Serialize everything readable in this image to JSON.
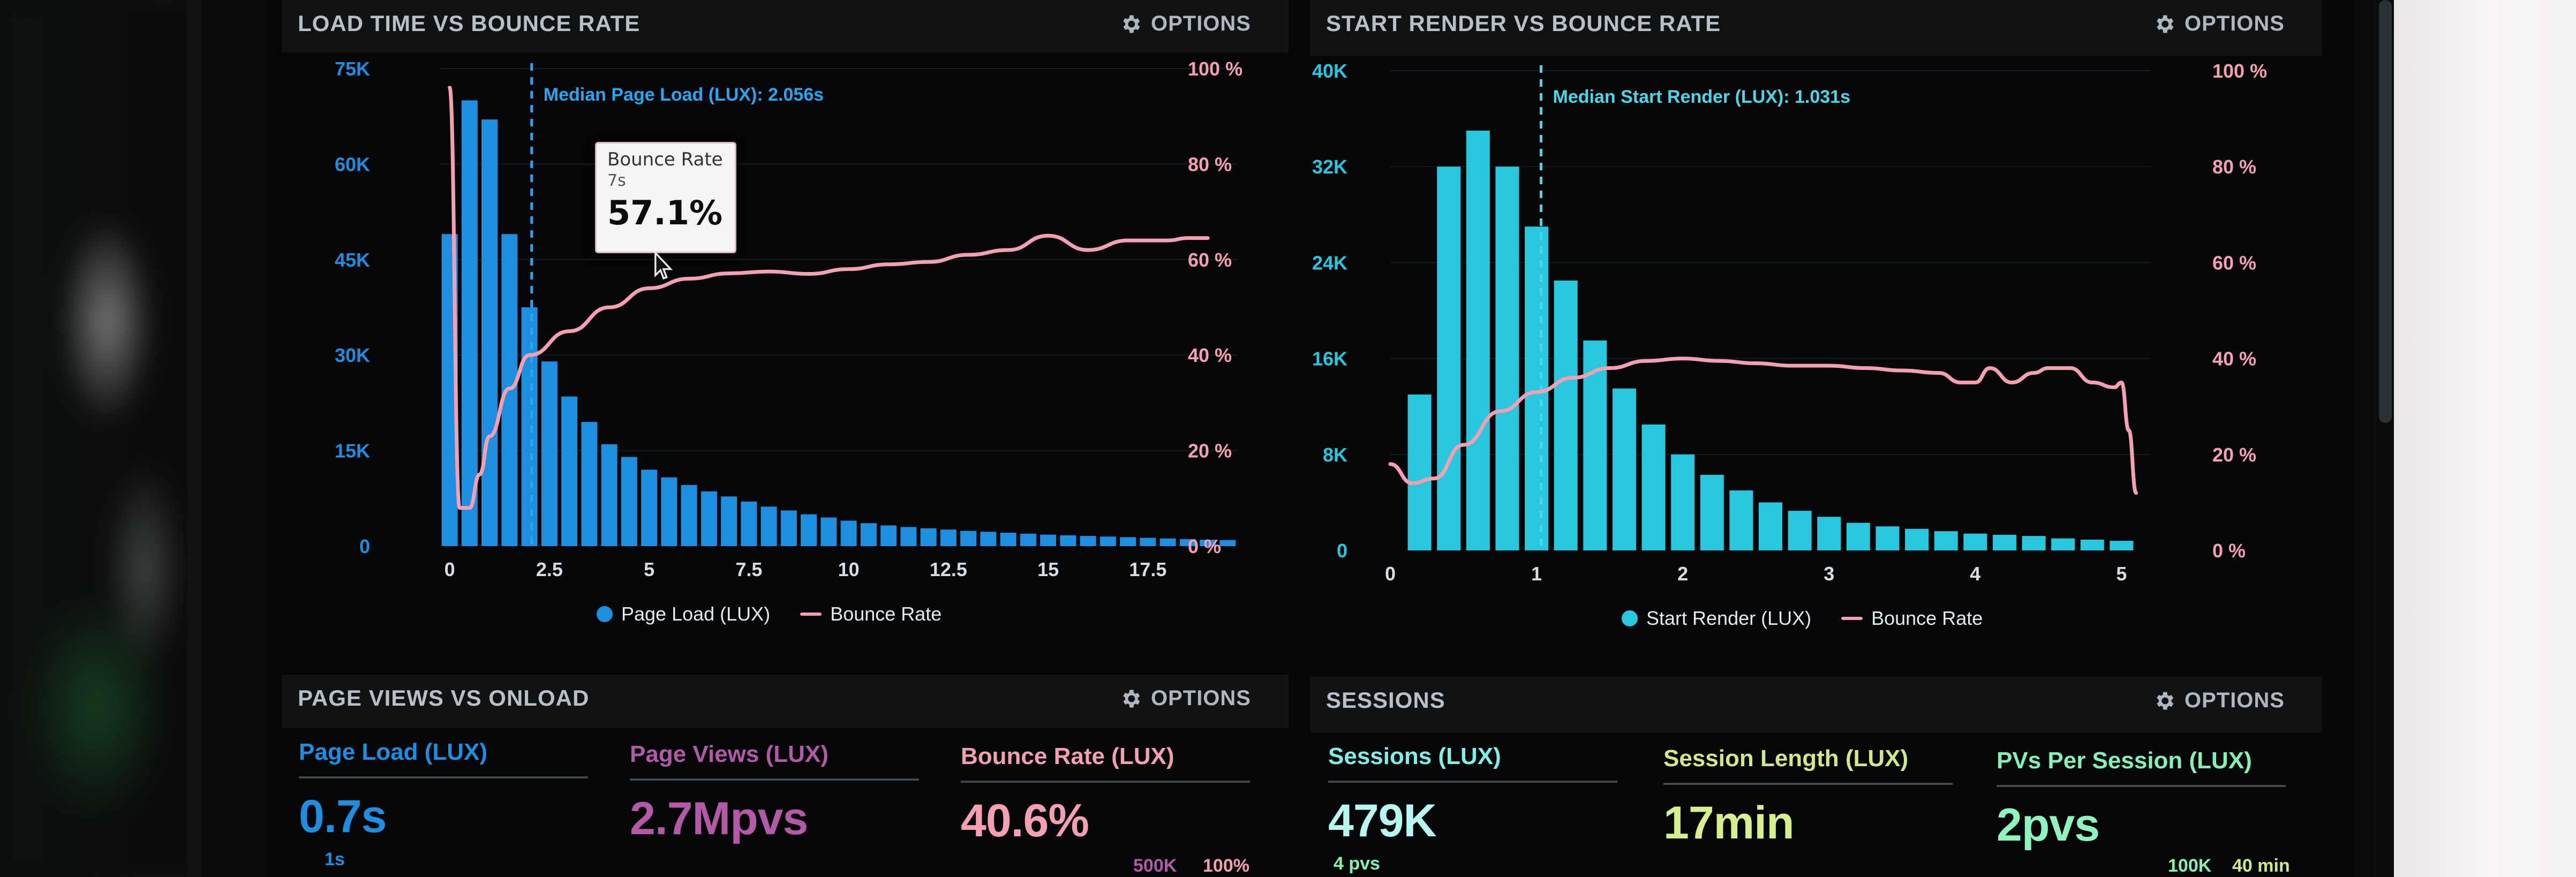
{
  "colors": {
    "blue": "#1e8fe0",
    "cyan": "#28c7df",
    "pink": "#f4a0b2",
    "purple": "#b25aa8",
    "lime": "#cfe88a",
    "mint": "#86f1b7",
    "grid": "#2a2f33"
  },
  "panels": {
    "top_left": {
      "title": "LOAD TIME VS BOUNCE RATE",
      "options_label": "OPTIONS",
      "median_label": "Median Page Load (LUX): 2.056s",
      "tooltip": {
        "label": "Bounce Rate",
        "sub": "7s",
        "value": "57.1%"
      },
      "legend": {
        "a": "Page Load (LUX)",
        "b": "Bounce Rate"
      }
    },
    "top_right": {
      "title": "START RENDER VS BOUNCE RATE",
      "options_label": "OPTIONS",
      "median_label": "Median Start Render (LUX): 1.031s",
      "legend": {
        "a": "Start Render (LUX)",
        "b": "Bounce Rate"
      }
    },
    "bottom_left": {
      "title": "PAGE VIEWS VS ONLOAD",
      "options_label": "OPTIONS",
      "metrics": [
        {
          "label": "Page Load (LUX)",
          "value": "0.7s"
        },
        {
          "label": "Page Views (LUX)",
          "value": "2.7Mpvs"
        },
        {
          "label": "Bounce Rate (LUX)",
          "value": "40.6%"
        }
      ],
      "bottom_labels": {
        "a": "1s",
        "b": "500K",
        "c": "100%"
      }
    },
    "bottom_right": {
      "title": "SESSIONS",
      "options_label": "OPTIONS",
      "metrics": [
        {
          "label": "Sessions (LUX)",
          "value": "479K"
        },
        {
          "label": "Session Length (LUX)",
          "value": "17min"
        },
        {
          "label": "PVs Per Session (LUX)",
          "value": "2pvs"
        }
      ],
      "bottom_labels": {
        "a": "4 pvs",
        "b": "100K",
        "c": "40 min"
      }
    }
  },
  "chart_data": [
    {
      "type": "bar",
      "title": "LOAD TIME VS BOUNCE RATE",
      "x_ticks": [
        "0",
        "2.5",
        "5",
        "7.5",
        "10",
        "12.5",
        "15",
        "17.5"
      ],
      "x_tick_values": [
        0,
        2.5,
        5,
        7.5,
        10,
        12.5,
        15,
        17.5
      ],
      "xlim": [
        -0.25,
        19.75
      ],
      "y_left_ticks": [
        "0",
        "15K",
        "30K",
        "45K",
        "60K",
        "75K"
      ],
      "y_left_tick_values": [
        0,
        15000,
        30000,
        45000,
        60000,
        75000
      ],
      "y_left_lim": [
        0,
        75000
      ],
      "y_right_ticks": [
        "0 %",
        "20 %",
        "40 %",
        "60 %",
        "80 %",
        "100 %"
      ],
      "y_right_tick_values": [
        0,
        20,
        40,
        60,
        80,
        100
      ],
      "y_right_lim": [
        0,
        100
      ],
      "median_x": 2.056,
      "bars": {
        "name": "Page Load (LUX)",
        "x": [
          0,
          0.5,
          1,
          1.5,
          2,
          2.5,
          3,
          3.5,
          4,
          4.5,
          5,
          5.5,
          6,
          6.5,
          7,
          7.5,
          8,
          8.5,
          9,
          9.5,
          10,
          10.5,
          11,
          11.5,
          12,
          12.5,
          13,
          13.5,
          14,
          14.5,
          15,
          15.5,
          16,
          16.5,
          17,
          17.5,
          18,
          18.5,
          19,
          19.5
        ],
        "values": [
          49000,
          70000,
          67000,
          49000,
          37500,
          29000,
          23500,
          19500,
          16000,
          14000,
          12000,
          10800,
          9600,
          8600,
          7800,
          7000,
          6200,
          5600,
          5000,
          4500,
          4000,
          3600,
          3250,
          3000,
          2800,
          2600,
          2400,
          2250,
          2100,
          1950,
          1800,
          1700,
          1600,
          1500,
          1400,
          1300,
          1200,
          1100,
          1000,
          950
        ]
      },
      "line": {
        "name": "Bounce Rate",
        "x": [
          0,
          0.25,
          0.5,
          0.75,
          1,
          1.5,
          2,
          3,
          4,
          5,
          6,
          7,
          8,
          9,
          10,
          11,
          12,
          13,
          14,
          15,
          16,
          17,
          17.5,
          18,
          18.5,
          19
        ],
        "values": [
          96,
          8,
          8,
          15,
          23,
          33,
          40,
          45,
          50,
          54,
          56,
          57.1,
          57.5,
          57,
          58,
          59,
          59.5,
          61,
          62,
          65,
          62,
          64,
          64,
          64,
          64.5,
          64.5
        ]
      }
    },
    {
      "type": "bar",
      "title": "START RENDER VS BOUNCE RATE",
      "x_ticks": [
        "0",
        "1",
        "2",
        "3",
        "4",
        "5"
      ],
      "x_tick_values": [
        0,
        1,
        2,
        3,
        4,
        5
      ],
      "xlim": [
        0,
        5.2
      ],
      "y_left_ticks": [
        "0",
        "8K",
        "16K",
        "24K",
        "32K",
        "40K"
      ],
      "y_left_tick_values": [
        0,
        8000,
        16000,
        24000,
        32000,
        40000
      ],
      "y_left_lim": [
        0,
        40000
      ],
      "y_right_ticks": [
        "0 %",
        "20 %",
        "40 %",
        "60 %",
        "80 %",
        "100 %"
      ],
      "y_right_tick_values": [
        0,
        20,
        40,
        60,
        80,
        100
      ],
      "y_right_lim": [
        0,
        100
      ],
      "median_x": 1.031,
      "bars": {
        "name": "Start Render (LUX)",
        "x": [
          0.2,
          0.4,
          0.6,
          0.8,
          1.0,
          1.2,
          1.4,
          1.6,
          1.8,
          2.0,
          2.2,
          2.4,
          2.6,
          2.8,
          3.0,
          3.2,
          3.4,
          3.6,
          3.8,
          4.0,
          4.2,
          4.4,
          4.6,
          4.8,
          5.0
        ],
        "values": [
          13000,
          32000,
          35000,
          32000,
          27000,
          22500,
          17500,
          13500,
          10500,
          8000,
          6300,
          5000,
          4000,
          3300,
          2800,
          2300,
          2000,
          1800,
          1600,
          1400,
          1300,
          1200,
          1000,
          900,
          800
        ]
      },
      "line": {
        "name": "Bounce Rate",
        "x": [
          0,
          0.15,
          0.3,
          0.5,
          0.75,
          1.0,
          1.25,
          1.5,
          1.75,
          2.0,
          2.25,
          2.5,
          2.75,
          3.0,
          3.25,
          3.5,
          3.75,
          3.9,
          4.0,
          4.1,
          4.25,
          4.4,
          4.5,
          4.65,
          4.8,
          4.95,
          5.0,
          5.05,
          5.1
        ],
        "values": [
          18,
          14,
          15,
          22,
          29,
          33,
          36,
          38,
          39.5,
          40,
          39.5,
          39,
          38.5,
          38.5,
          38,
          37.5,
          37,
          35,
          35,
          38,
          35,
          37,
          38,
          38,
          35,
          34,
          35,
          25,
          12
        ]
      }
    }
  ]
}
